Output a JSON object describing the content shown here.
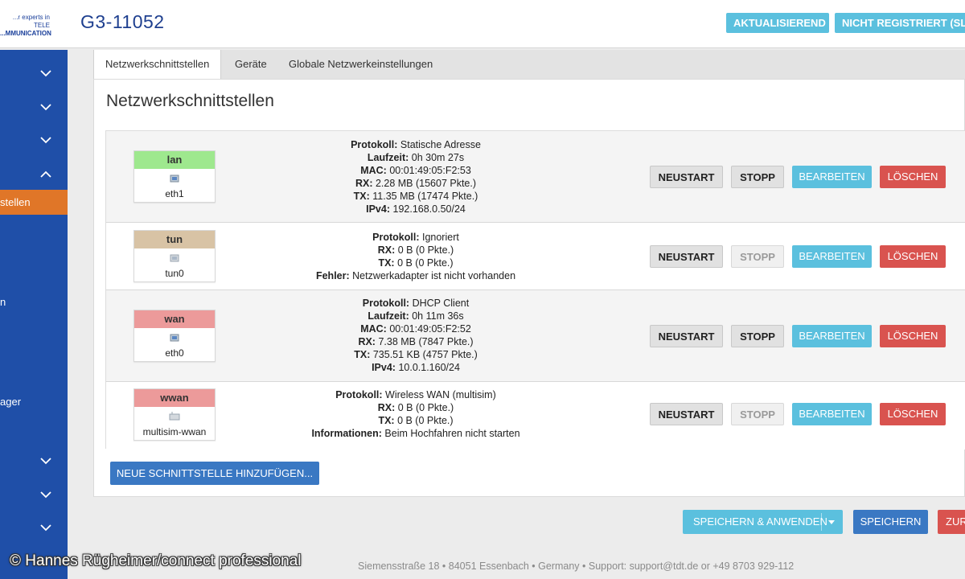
{
  "header": {
    "logo_line1": "...r experts in TELE",
    "logo_line2": "...MMUNICATION",
    "hostname": "G3-11052",
    "btn_updating": "AKTUALISIEREND",
    "btn_not_registered": "NICHT REGISTRIERT (SLO"
  },
  "sidebar": {
    "active_item": "stellen",
    "text_item_1": "n",
    "text_item_2": "ager"
  },
  "tabs": [
    {
      "label": "Netzwerkschnittstellen"
    },
    {
      "label": "Geräte"
    },
    {
      "label": "Globale Netzwerkeinstellungen"
    }
  ],
  "page_title": "Netzwerkschnittstellen",
  "interfaces": [
    {
      "name": "lan",
      "device": "eth1",
      "color": "#9ee88e",
      "lines": [
        {
          "k": "Protokoll:",
          "v": " Statische Adresse"
        },
        {
          "k": "Laufzeit:",
          "v": " 0h 30m 27s"
        },
        {
          "k": "MAC:",
          "v": " 00:01:49:05:F2:53"
        },
        {
          "k": "RX:",
          "v": " 2.28 MB (15607 Pkte.)"
        },
        {
          "k": "TX:",
          "v": " 11.35 MB (17474 Pkte.)"
        },
        {
          "k": "IPv4:",
          "v": " 192.168.0.50/24"
        }
      ]
    },
    {
      "name": "tun",
      "device": "tun0",
      "color": "#d8c3a5",
      "lines": [
        {
          "k": "Protokoll:",
          "v": " Ignoriert"
        },
        {
          "k": "RX:",
          "v": " 0 B (0 Pkte.)"
        },
        {
          "k": "TX:",
          "v": " 0 B (0 Pkte.)"
        },
        {
          "k": "Fehler:",
          "v": " Netzwerkadapter ist nicht vorhanden"
        }
      ]
    },
    {
      "name": "wan",
      "device": "eth0",
      "color": "#ec9a9a",
      "lines": [
        {
          "k": "Protokoll:",
          "v": " DHCP Client"
        },
        {
          "k": "Laufzeit:",
          "v": " 0h 11m 36s"
        },
        {
          "k": "MAC:",
          "v": " 00:01:49:05:F2:52"
        },
        {
          "k": "RX:",
          "v": " 7.38 MB (7847 Pkte.)"
        },
        {
          "k": "TX:",
          "v": " 735.51 KB (4757 Pkte.)"
        },
        {
          "k": "IPv4:",
          "v": " 10.0.1.160/24"
        }
      ]
    },
    {
      "name": "wwan",
      "device": "multisim-wwan",
      "color": "#ec9a9a",
      "lines": [
        {
          "k": "Protokoll:",
          "v": " Wireless WAN (multisim)"
        },
        {
          "k": "RX:",
          "v": " 0 B (0 Pkte.)"
        },
        {
          "k": "TX:",
          "v": " 0 B (0 Pkte.)"
        },
        {
          "k": "Informationen:",
          "v": " Beim Hochfahren nicht starten"
        }
      ]
    }
  ],
  "buttons": {
    "restart": "NEUSTART",
    "stop": "STOPP",
    "edit": "BEARBEITEN",
    "delete": "LÖSCHEN",
    "add_interface": "NEUE SCHNITTSTELLE HINZUFÜGEN...",
    "save_apply": "SPEICHERN & ANWENDEN",
    "save": "SPEICHERN",
    "reset": "ZUR"
  },
  "footer": "Siemensstraße 18 • 84051 Essenbach • Germany • Support: support@tdt.de or +49 8703 929-112",
  "copyright": "© Hannes Rügheimer/connect professional"
}
